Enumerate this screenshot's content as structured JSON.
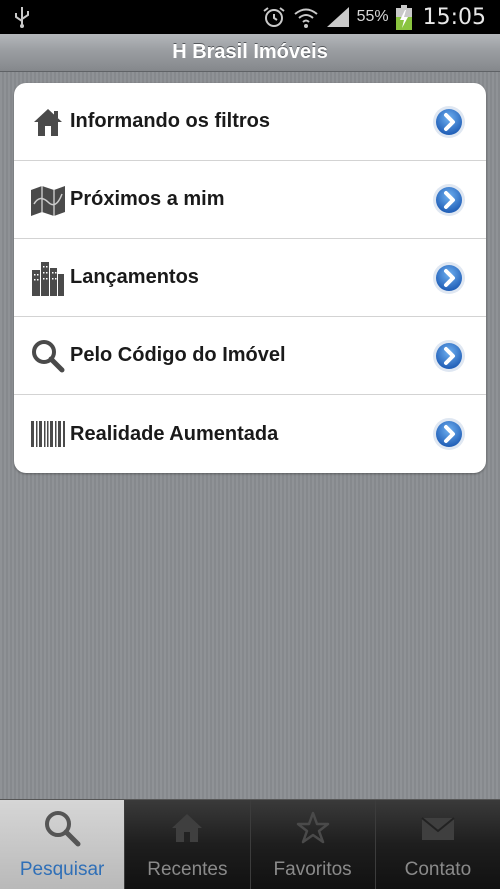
{
  "status_bar": {
    "battery_percent": "55%",
    "time": "15:05",
    "icons": [
      "usb-icon",
      "alarm-icon",
      "wifi-icon",
      "signal-icon",
      "battery-charging-icon"
    ]
  },
  "header": {
    "title": "H Brasil Imóveis"
  },
  "menu": {
    "items": [
      {
        "label": "Informando os filtros",
        "icon": "house-icon"
      },
      {
        "label": "Próximos a mim",
        "icon": "map-icon"
      },
      {
        "label": "Lançamentos",
        "icon": "buildings-icon"
      },
      {
        "label": "Pelo Código do Imóvel",
        "icon": "magnifier-icon"
      },
      {
        "label": "Realidade Aumentada",
        "icon": "barcode-icon"
      }
    ]
  },
  "tabs": [
    {
      "label": "Pesquisar",
      "icon": "search-icon",
      "active": true
    },
    {
      "label": "Recentes",
      "icon": "home-icon",
      "active": false
    },
    {
      "label": "Favoritos",
      "icon": "star-icon",
      "active": false
    },
    {
      "label": "Contato",
      "icon": "mail-icon",
      "active": false
    }
  ],
  "colors": {
    "accent_blue": "#2f6fb7",
    "background": "#8b8e92",
    "active_tab": "#c8c8c8"
  }
}
